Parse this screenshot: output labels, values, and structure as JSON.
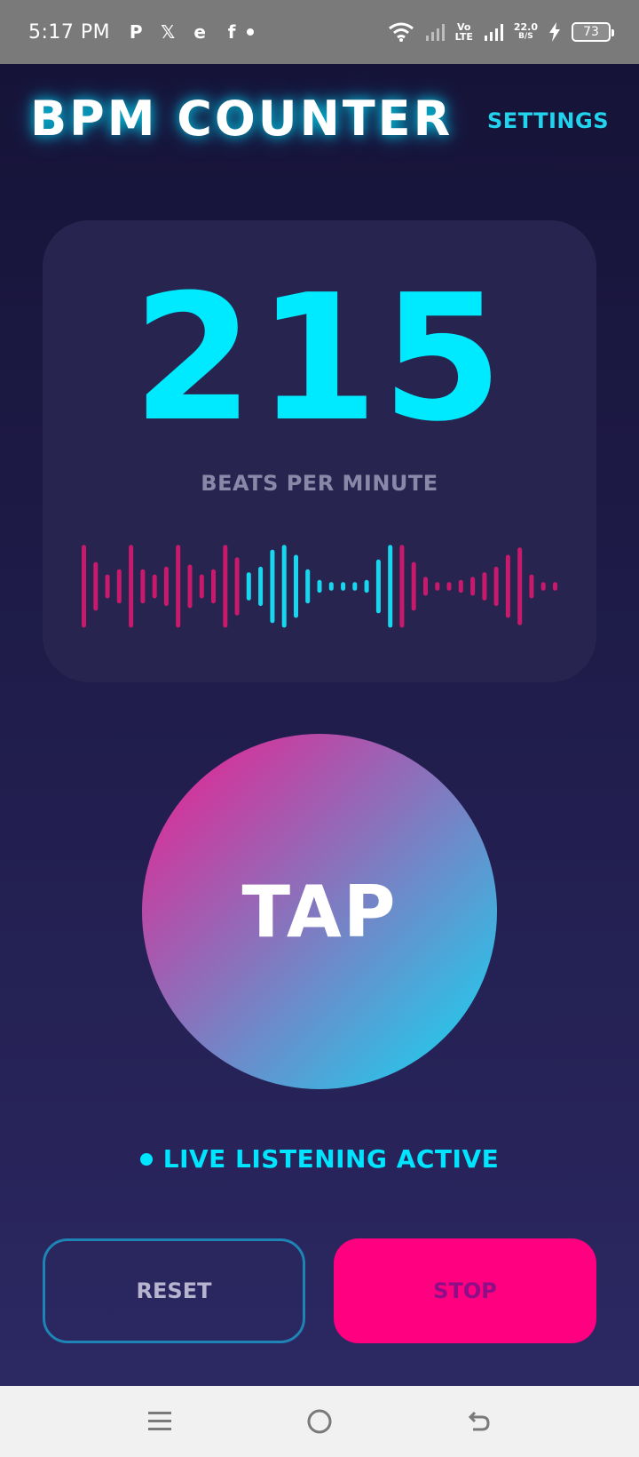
{
  "status_bar": {
    "time": "5:17 PM",
    "notification_icons": [
      "paytm-icon",
      "x-icon",
      "edge-icon",
      "facebook-icon"
    ],
    "volte_top": "Vo",
    "volte_bottom": "LTE",
    "speed_value": "22.0",
    "speed_unit": "B/S",
    "battery": "73"
  },
  "header": {
    "title": "BPM COUNTER",
    "settings_label": "SETTINGS"
  },
  "bpm": {
    "value": "215",
    "caption": "BEATS PER MINUTE"
  },
  "waveform": {
    "colors": {
      "pink": "#c8196c",
      "cyan": "#19d6ef"
    },
    "bars": [
      {
        "h": 0.97,
        "c": "pink"
      },
      {
        "h": 0.57,
        "c": "pink"
      },
      {
        "h": 0.28,
        "c": "pink"
      },
      {
        "h": 0.4,
        "c": "pink"
      },
      {
        "h": 0.97,
        "c": "pink"
      },
      {
        "h": 0.4,
        "c": "pink"
      },
      {
        "h": 0.28,
        "c": "pink"
      },
      {
        "h": 0.46,
        "c": "pink"
      },
      {
        "h": 0.97,
        "c": "pink"
      },
      {
        "h": 0.51,
        "c": "pink"
      },
      {
        "h": 0.28,
        "c": "pink"
      },
      {
        "h": 0.4,
        "c": "pink"
      },
      {
        "h": 0.97,
        "c": "pink"
      },
      {
        "h": 0.68,
        "c": "pink"
      },
      {
        "h": 0.33,
        "c": "cyan"
      },
      {
        "h": 0.46,
        "c": "cyan"
      },
      {
        "h": 0.86,
        "c": "cyan"
      },
      {
        "h": 0.97,
        "c": "cyan"
      },
      {
        "h": 0.74,
        "c": "cyan"
      },
      {
        "h": 0.4,
        "c": "cyan"
      },
      {
        "h": 0.15,
        "c": "cyan"
      },
      {
        "h": 0.1,
        "c": "cyan"
      },
      {
        "h": 0.1,
        "c": "cyan"
      },
      {
        "h": 0.1,
        "c": "cyan"
      },
      {
        "h": 0.15,
        "c": "cyan"
      },
      {
        "h": 0.63,
        "c": "cyan"
      },
      {
        "h": 0.97,
        "c": "cyan"
      },
      {
        "h": 0.97,
        "c": "pink"
      },
      {
        "h": 0.57,
        "c": "pink"
      },
      {
        "h": 0.22,
        "c": "pink"
      },
      {
        "h": 0.1,
        "c": "pink"
      },
      {
        "h": 0.1,
        "c": "pink"
      },
      {
        "h": 0.15,
        "c": "pink"
      },
      {
        "h": 0.22,
        "c": "pink"
      },
      {
        "h": 0.33,
        "c": "pink"
      },
      {
        "h": 0.46,
        "c": "pink"
      },
      {
        "h": 0.74,
        "c": "pink"
      },
      {
        "h": 0.91,
        "c": "pink"
      },
      {
        "h": 0.28,
        "c": "pink"
      },
      {
        "h": 0.1,
        "c": "pink"
      },
      {
        "h": 0.1,
        "c": "pink"
      }
    ]
  },
  "tap": {
    "label": "TAP"
  },
  "live_status": {
    "label": "LIVE LISTENING ACTIVE"
  },
  "buttons": {
    "reset_label": "RESET",
    "stop_label": "STOP"
  },
  "nav": {
    "icons": [
      "menu-icon",
      "home-icon",
      "back-icon"
    ]
  }
}
